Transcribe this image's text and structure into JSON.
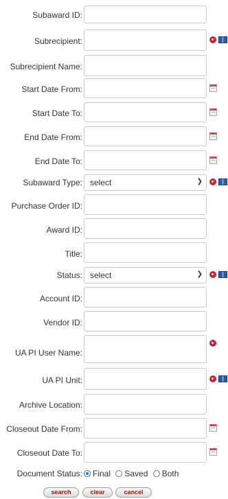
{
  "fields": {
    "subaward_id": "Subaward ID:",
    "subrecipient": "Subrecipient:",
    "subrecipient_name": "Subrecipient Name:",
    "start_date_from": "Start Date From:",
    "start_date_to": "Start Date To:",
    "end_date_from": "End Date From:",
    "end_date_to": "End Date To:",
    "subaward_type": "Subaward Type:",
    "purchase_order_id": "Purchase Order ID:",
    "award_id": "Award ID:",
    "title": "Title:",
    "status": "Status:",
    "account_id": "Account ID:",
    "vendor_id": "Vendor ID:",
    "ua_pi_user_name": "UA PI User Name:",
    "ua_pi_unit": "UA PI Unit:",
    "archive_location": "Archive Location:",
    "closeout_date_from": "Closeout Date From:",
    "closeout_date_to": "Closeout Date To:",
    "document_status": "Document Status:"
  },
  "selects": {
    "subaward_type_value": "select",
    "status_value": "select"
  },
  "document_status_options": {
    "final": "Final",
    "saved": "Saved",
    "both": "Both",
    "selected": "Final"
  },
  "buttons": {
    "search": "search",
    "clear": "clear",
    "cancel": "cancel"
  },
  "icons": {
    "lookup": "magnifier-lookup-icon",
    "direct_inquiry": "book-inquiry-icon",
    "calendar": "calendar-icon"
  }
}
